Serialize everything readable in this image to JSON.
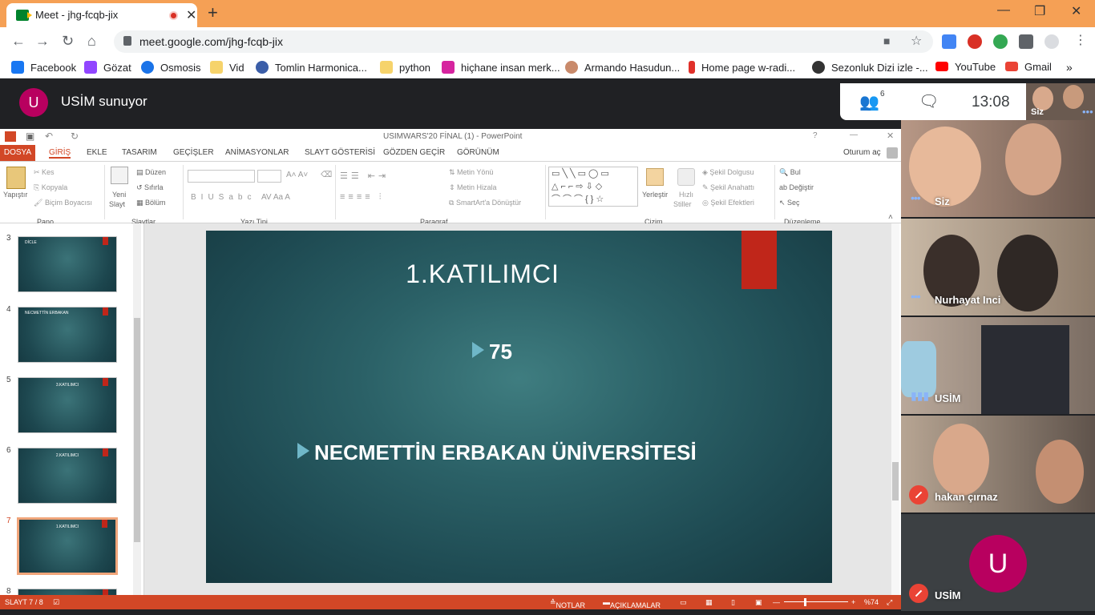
{
  "browser": {
    "tab_title": "Meet - jhg-fcqb-jix",
    "url": "meet.google.com/jhg-fcqb-jix",
    "bookmarks": [
      "Facebook",
      "Gözat",
      "Osmosis",
      "Vid",
      "Tomlin Harmonica...",
      "python",
      "hiçhane insan merk...",
      "Armando Hasudun...",
      "Home page w-radi...",
      "Sezonluk Dizi izle -...",
      "YouTube",
      "Gmail"
    ]
  },
  "meet": {
    "presenter_initial": "U",
    "presenting_text": "USİM sunuyor",
    "participant_count": "6",
    "time": "13:08",
    "self_label": "Siz",
    "participants": [
      {
        "name": "Siz"
      },
      {
        "name": "Nurhayat Inci"
      },
      {
        "name": "USİM"
      },
      {
        "name": "hakan çırnaz"
      },
      {
        "name": "USİM",
        "initial": "U"
      }
    ]
  },
  "ppt": {
    "window_title": "USIMWARS'20 FİNAL (1) - PowerPoint",
    "tabs": [
      "DOSYA",
      "GİRİŞ",
      "EKLE",
      "TASARIM",
      "GEÇİŞLER",
      "ANİMASYONLAR",
      "SLAYT GÖSTERİSİ",
      "GÖZDEN GEÇİR",
      "GÖRÜNÜM"
    ],
    "signin": "Oturum aç",
    "ribbon": {
      "paste": "Yapıştır",
      "cut": "Kes",
      "copy": "Kopyala",
      "format_painter": "Biçim Boyacısı",
      "new_slide_1": "Yeni",
      "new_slide_2": "Slayt",
      "layout": "Düzen",
      "reset": "Sıfırla",
      "section": "Bölüm",
      "text_direction": "Metin Yönü",
      "align_text": "Metin Hizala",
      "smartart": "SmartArt'a Dönüştür",
      "arrange": "Yerleştir",
      "quick_styles_1": "Hızlı",
      "quick_styles_2": "Stiller",
      "shape_fill": "Şekil Dolgusu",
      "shape_outline": "Şekil Anahattı",
      "shape_effects": "Şekil Efektleri",
      "find": "Bul",
      "replace": "Değiştir",
      "select": "Seç",
      "groups": [
        "Pano",
        "Slaytlar",
        "Yazı Tipi",
        "Paragraf",
        "Çizim",
        "Düzenleme"
      ]
    },
    "thumbnails": [
      {
        "num": "3",
        "title": "DİCLE"
      },
      {
        "num": "4",
        "title": "NECMETTİN ERBAKAN"
      },
      {
        "num": "5",
        "title": "3.KATILIMCI"
      },
      {
        "num": "6",
        "title": "2.KATILIMCI"
      },
      {
        "num": "7",
        "title": "1.KATILIMCI"
      },
      {
        "num": "8",
        "title": ""
      }
    ],
    "slide": {
      "title": "1.KATILIMCI",
      "bullet1": "75",
      "bullet2": "NECMETTİN ERBAKAN ÜNİVERSİTESİ"
    },
    "status": {
      "slide_counter": "SLAYT 7 / 8",
      "notes": "NOTLAR",
      "comments": "AÇIKLAMALAR",
      "zoom": "%74"
    }
  }
}
